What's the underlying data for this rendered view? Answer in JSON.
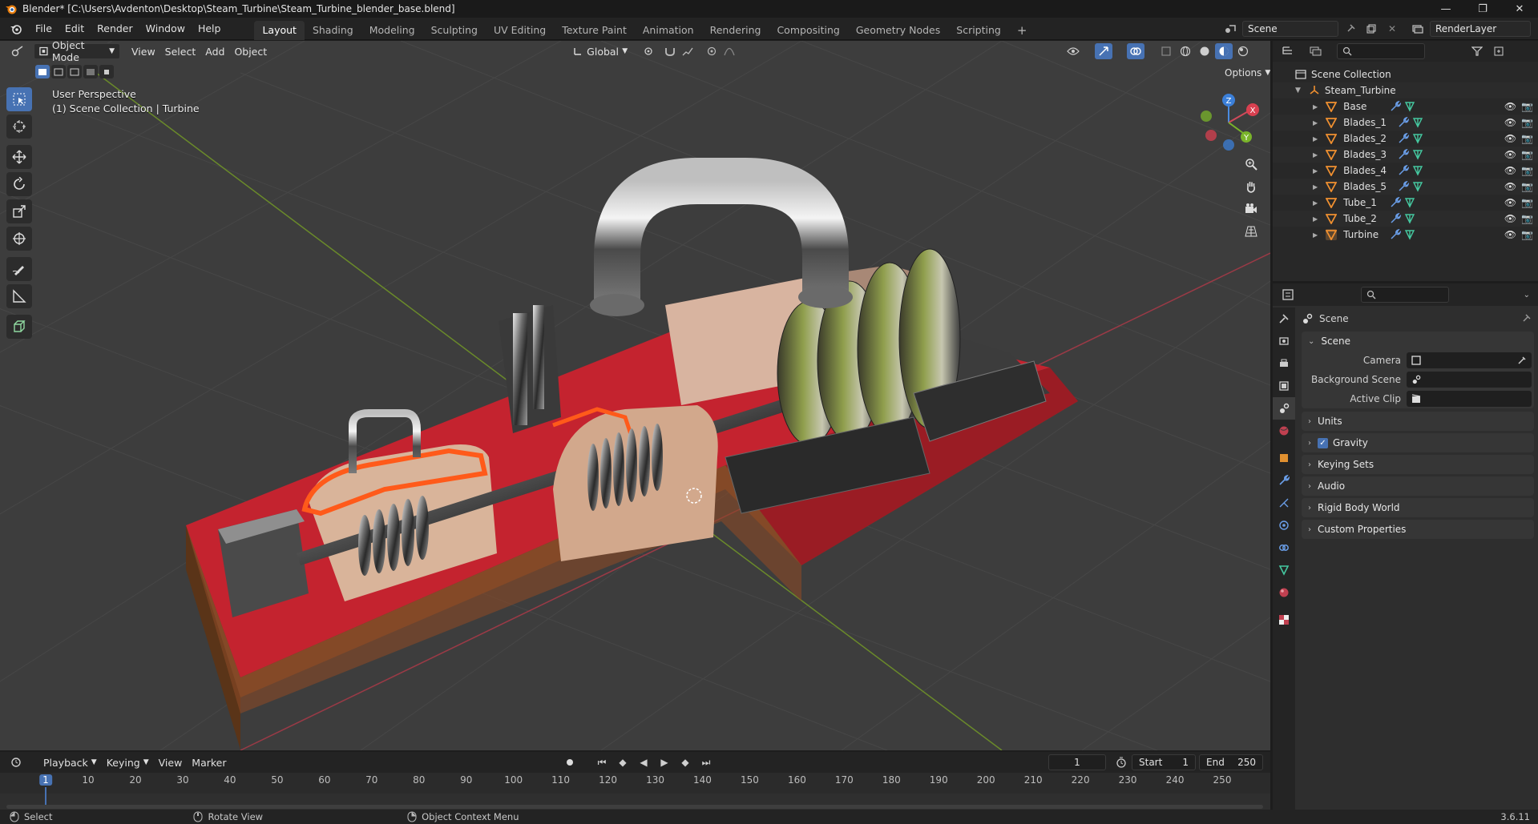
{
  "window": {
    "title": "Blender* [C:\\Users\\Avdenton\\Desktop\\Steam_Turbine\\Steam_Turbine_blender_base.blend]",
    "controls": [
      "—",
      "❐",
      "✕"
    ]
  },
  "menu": [
    "File",
    "Edit",
    "Render",
    "Window",
    "Help"
  ],
  "workspaces": {
    "active": "Layout",
    "tabs": [
      "Layout",
      "Shading",
      "Modeling",
      "Sculpting",
      "UV Editing",
      "Texture Paint",
      "Animation",
      "Rendering",
      "Compositing",
      "Geometry Nodes",
      "Scripting"
    ],
    "add": "+"
  },
  "scene_selector": {
    "scene": "Scene",
    "view_layer": "RenderLayer"
  },
  "viewport": {
    "mode": "Object Mode",
    "menus": [
      "View",
      "Select",
      "Add",
      "Object"
    ],
    "orientation": "Global",
    "options_label": "Options",
    "overlay_title": "User Perspective",
    "overlay_subtitle": "(1) Scene Collection | Turbine",
    "gizmo_axes": {
      "z": "Z",
      "y": "Y",
      "x": "X"
    },
    "colors": {
      "background": "#3d3d3d",
      "grid": "#484848",
      "x_axis": "#9a3a46",
      "y_axis": "#6a8a2a",
      "accent": "#4772b3"
    }
  },
  "outliner": {
    "root": "Scene Collection",
    "collection": "Steam_Turbine",
    "objects": [
      "Base",
      "Blades_1",
      "Blades_2",
      "Blades_3",
      "Blades_4",
      "Blades_5",
      "Tube_1",
      "Tube_2",
      "Turbine"
    ]
  },
  "properties": {
    "context": "Scene",
    "panel_title": "Scene",
    "fields": [
      {
        "label": "Camera",
        "value": ""
      },
      {
        "label": "Background Scene",
        "value": ""
      },
      {
        "label": "Active Clip",
        "value": ""
      }
    ],
    "collapsed_panels": [
      "Units",
      "Gravity",
      "Keying Sets",
      "Audio",
      "Rigid Body World",
      "Custom Properties"
    ],
    "gravity_checked": true
  },
  "timeline": {
    "menus": [
      "Playback",
      "Keying",
      "View",
      "Marker"
    ],
    "current_frame": "1",
    "start_label": "Start",
    "start": "1",
    "end_label": "End",
    "end": "250",
    "ticks": [
      "1",
      "10",
      "20",
      "30",
      "40",
      "50",
      "60",
      "70",
      "80",
      "90",
      "100",
      "110",
      "120",
      "130",
      "140",
      "150",
      "160",
      "170",
      "180",
      "190",
      "200",
      "210",
      "220",
      "230",
      "240",
      "250"
    ]
  },
  "status": {
    "left": "Select",
    "middle": "Rotate View",
    "right": "Object Context Menu",
    "version": "3.6.11"
  }
}
